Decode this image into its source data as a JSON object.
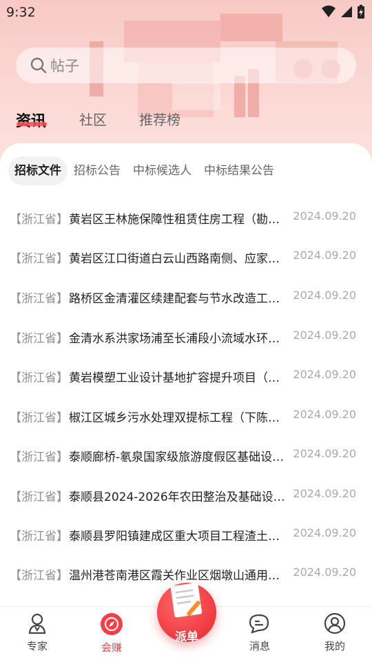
{
  "status_bar": {
    "time": "9:32"
  },
  "search": {
    "placeholder": "帖子"
  },
  "main_tabs": [
    {
      "label": "资讯",
      "active": true
    },
    {
      "label": "社区",
      "active": false
    },
    {
      "label": "推荐榜",
      "active": false
    }
  ],
  "sub_tabs": [
    {
      "label": "招标文件",
      "active": true
    },
    {
      "label": "招标公告",
      "active": false
    },
    {
      "label": "中标候选人",
      "active": false
    },
    {
      "label": "中标结果公告",
      "active": false
    }
  ],
  "list": [
    {
      "region": "【浙江省】",
      "title": "黄岩区王林施保障性租赁住房工程（勘…",
      "date": "2024.09.20"
    },
    {
      "region": "【浙江省】",
      "title": "黄岩区江口街道白云山西路南侧、应家…",
      "date": "2024.09.20"
    },
    {
      "region": "【浙江省】",
      "title": "路桥区金清灌区续建配套与节水改造工…",
      "date": "2024.09.20"
    },
    {
      "region": "【浙江省】",
      "title": "金清水系洪家场浦至长浦段小流域水环…",
      "date": "2024.09.20"
    },
    {
      "region": "【浙江省】",
      "title": "黄岩模塑工业设计基地扩容提升项目（…",
      "date": "2024.09.20"
    },
    {
      "region": "【浙江省】",
      "title": "椒江区城乡污水处理双提标工程（下陈…",
      "date": "2024.09.20"
    },
    {
      "region": "【浙江省】",
      "title": "泰顺廊桥-氡泉国家级旅游度假区基础设…",
      "date": "2024.09.20"
    },
    {
      "region": "【浙江省】",
      "title": "泰顺县2024-2026年农田整治及基础设…",
      "date": "2024.09.20"
    },
    {
      "region": "【浙江省】",
      "title": "泰顺县罗阳镇建成区重大项目工程渣土…",
      "date": "2024.09.20"
    },
    {
      "region": "【浙江省】",
      "title": "温州港苍南港区霞关作业区烟墩山通用…",
      "date": "2024.09.20"
    }
  ],
  "tabbar": {
    "items": [
      {
        "label": "专家",
        "icon": "expert-icon",
        "active": false
      },
      {
        "label": "会赚",
        "icon": "compass-icon",
        "active": true
      },
      {
        "label": "消息",
        "icon": "message-icon",
        "active": false
      },
      {
        "label": "我的",
        "icon": "profile-icon",
        "active": false
      }
    ],
    "center_button": {
      "label": "派单",
      "icon": "dispatch-document-icon"
    }
  },
  "colors": {
    "accent": "#ff3b45",
    "hero_bg": "#f9cfcb"
  }
}
